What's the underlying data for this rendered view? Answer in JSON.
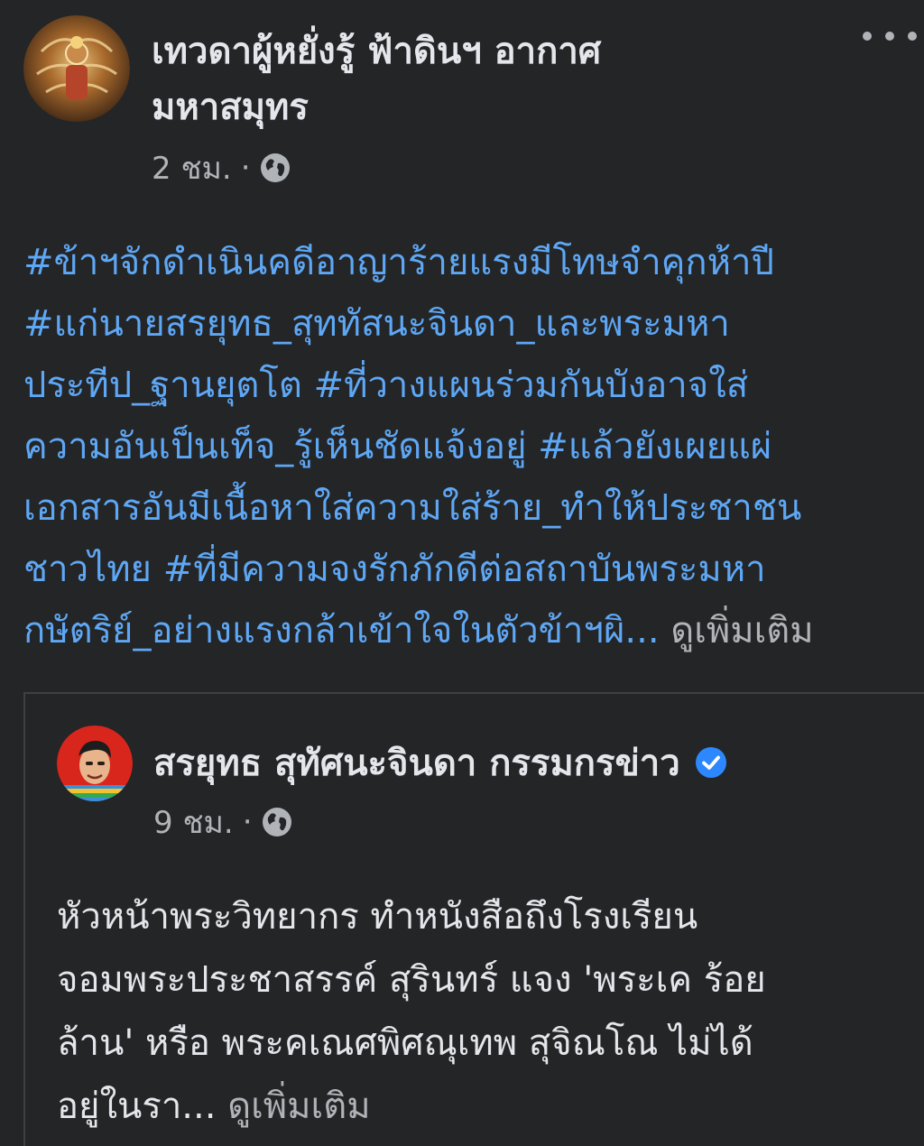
{
  "post": {
    "author_name_line1": "เทวดาผู้หยั่งรู้ ฟ้าดินฯ อากาศ",
    "author_name_line2": "มหาสมุทร",
    "time": "2 ชม.",
    "separator": "·",
    "privacy_icon": "globe-icon",
    "more_icon": "more-dots-icon",
    "text_lines": [
      "#ข้าฯจักดำเนินคดีอาญาร้ายแรงมีโทษจำคุกห้าปี",
      "#แก่นายสรยุทธ_สุททัสนะจินดา_และพระมหา",
      "ประทีป_ฐานยุตโต  #ที่วางแผนร่วมกันบังอาจใส่",
      "ความอันเป็นเท็จ_รู้เห็นชัดแจ้งอยู่  #แล้วยังเผยแผ่",
      "เอกสารอันมีเนื้อหาใส่ความใส่ร้าย_ทำให้ประชาชน",
      "ชาวไทย #ที่มีความจงรักภักดีต่อสถาบันพระมหา",
      "กษัตริย์_อย่างแรงกล้าเข้าใจในตัวข้าฯผิ..."
    ],
    "see_more": "ดูเพิ่มเติม"
  },
  "shared_post": {
    "author_name": "สรยุทธ สุทัศนะจินดา กรรมกรข่าว",
    "verified_icon": "verified-badge-icon",
    "time": "9 ชม.",
    "separator": "·",
    "privacy_icon": "globe-icon",
    "text_lines": [
      "หัวหน้าพระวิทยากร ทำหนังสือถึงโรงเรียน",
      "จอมพระประชาสรรค์ สุรินทร์ แจง 'พระเค ร้อย",
      "ล้าน' หรือ พระคเณศพิศณุเทพ สุจิณโณ ไม่ได้",
      "อยู่ในรา..."
    ],
    "see_more": "ดูเพิ่มเติม"
  },
  "colors": {
    "background": "#242526",
    "hashtag": "#5ea7f5",
    "text": "#e4e6eb",
    "secondary": "#b0b3b8",
    "verified": "#2d88ff"
  }
}
